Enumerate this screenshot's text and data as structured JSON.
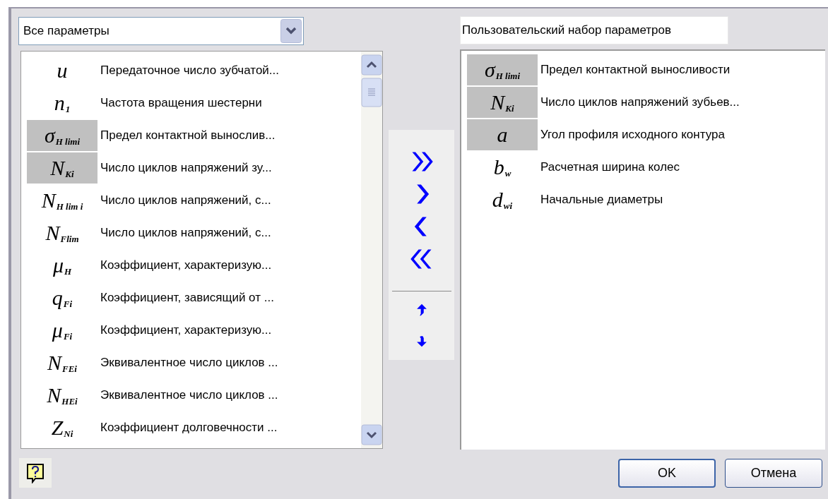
{
  "filter_select": {
    "value": "Все параметры"
  },
  "available_parameters": [
    {
      "symbol": {
        "base": "u"
      },
      "label": "Передаточное число зубчатой...",
      "highlighted": false
    },
    {
      "symbol": {
        "base": "n",
        "sub": "1"
      },
      "label": "Частота вращения шестерни",
      "highlighted": false
    },
    {
      "symbol": {
        "base": "σ",
        "sub": "H limi"
      },
      "label": "Предел контактной вынослив...",
      "highlighted": true
    },
    {
      "symbol": {
        "base": "N",
        "sub": "Ki"
      },
      "label": "Число циклов напряжений зу...",
      "highlighted": true
    },
    {
      "symbol": {
        "base": "N",
        "sub": "H lim i"
      },
      "label": "Число циклов напряжений, с...",
      "highlighted": false
    },
    {
      "symbol": {
        "base": "N",
        "sub": "Flim"
      },
      "label": "Число циклов напряжений, с...",
      "highlighted": false
    },
    {
      "symbol": {
        "base": "μ",
        "sub": "H"
      },
      "label": "Коэффициент, характеризую...",
      "highlighted": false
    },
    {
      "symbol": {
        "base": "q",
        "sub": "Fi"
      },
      "label": "Коэффициент, зависящий от ...",
      "highlighted": false
    },
    {
      "symbol": {
        "base": "μ",
        "sub": "Fi"
      },
      "label": "Коэффициент, характеризую...",
      "highlighted": false
    },
    {
      "symbol": {
        "base": "N",
        "sub": "FEi"
      },
      "label": "Эквивалентное число циклов ...",
      "highlighted": false
    },
    {
      "symbol": {
        "base": "N",
        "sub": "HEi"
      },
      "label": "Эквивалентное число циклов ...",
      "highlighted": false
    },
    {
      "symbol": {
        "base": "Z",
        "sub": "Ni"
      },
      "label": "Коэффициент долговечности ...",
      "highlighted": false
    }
  ],
  "set_name": {
    "value": "Пользовательский набор параметров"
  },
  "selected_parameters": [
    {
      "symbol": {
        "base": "σ",
        "sub": "H limi"
      },
      "label": "Предел контактной выносливости",
      "highlighted": true
    },
    {
      "symbol": {
        "base": "N",
        "sub": "Ki"
      },
      "label": "Число циклов напряжений зубьев...",
      "highlighted": true
    },
    {
      "symbol": {
        "base": "a"
      },
      "label": "Угол профиля исходного контура",
      "highlighted": true
    },
    {
      "symbol": {
        "base": "b",
        "sub": "w"
      },
      "label": "Расчетная ширина колес",
      "highlighted": false
    },
    {
      "symbol": {
        "base": "d",
        "sub": "wi"
      },
      "label": "Начальные диаметры",
      "highlighted": false
    }
  ],
  "transfer_buttons": [
    {
      "kind": "add_all"
    },
    {
      "kind": "add"
    },
    {
      "kind": "remove"
    },
    {
      "kind": "remove_all"
    }
  ],
  "order_buttons": [
    {
      "kind": "up"
    },
    {
      "kind": "down"
    }
  ],
  "buttons": [
    {
      "label": "OK",
      "default": true
    },
    {
      "label": "Отмена",
      "default": false
    }
  ]
}
